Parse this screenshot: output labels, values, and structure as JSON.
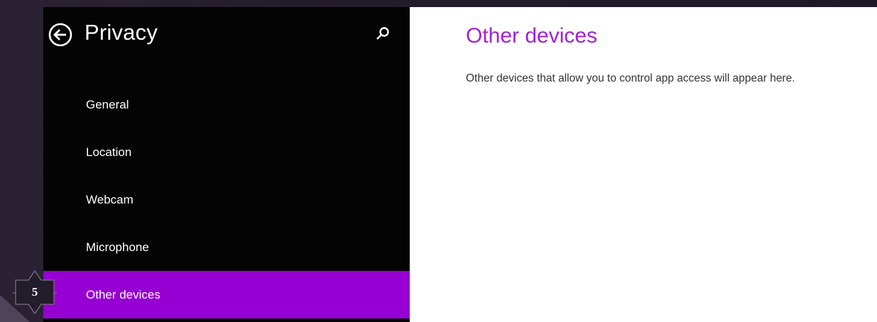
{
  "pane": {
    "title": "Privacy",
    "back_icon": "back-arrow-circle-icon",
    "search_icon": "search-icon"
  },
  "nav": {
    "items": [
      {
        "label": "General"
      },
      {
        "label": "Location"
      },
      {
        "label": "Webcam"
      },
      {
        "label": "Microphone"
      },
      {
        "label": "Other devices",
        "selected": true
      }
    ]
  },
  "content": {
    "title": "Other devices",
    "description": "Other devices that allow you to control app access will appear here."
  },
  "annotation": {
    "step_number": "5"
  },
  "colors": {
    "accent": "#9600d2",
    "title_accent": "#a21fd6",
    "pane_bg": "#040404",
    "backdrop": "#231c2b"
  }
}
